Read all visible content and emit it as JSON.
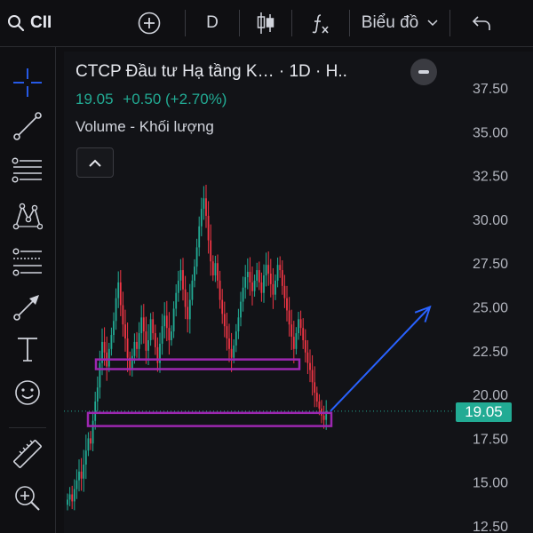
{
  "toolbar": {
    "symbol": "CII",
    "interval": "D",
    "chart_type_label": "Biểu đồ",
    "icons": [
      "search-icon",
      "add-icon",
      "candles-icon",
      "function-icon",
      "chevron-down-icon",
      "undo-icon"
    ]
  },
  "sidebar": {
    "tools": [
      "crosshair-icon",
      "trend-line-icon",
      "fib-icon",
      "pattern-icon",
      "forecast-icon",
      "arrow-icon",
      "text-icon",
      "emoji-icon",
      "ruler-icon",
      "zoom-in-icon"
    ]
  },
  "legend": {
    "title": "CTCP Đầu tư Hạ tầng K… · 1D · H..",
    "price": "19.05",
    "change": "+0.50 (+2.70%)",
    "volume_label": "Volume - Khối lượng"
  },
  "price_axis": {
    "current_price": "19.05",
    "ticks": [
      "37.50",
      "35.00",
      "32.50",
      "30.00",
      "27.50",
      "25.00",
      "22.50",
      "20.00",
      "17.50",
      "15.00",
      "12.50"
    ]
  },
  "colors": {
    "up": "#22ab94",
    "down": "#f23645",
    "rectangle": "#9c27b0",
    "arrow": "#2962ff",
    "background": "#121317"
  },
  "chart_data": {
    "type": "candlestick",
    "ylim": [
      12.5,
      37.5
    ],
    "y_axis_side": "right",
    "grid": false,
    "current_price": 19.05,
    "closes": [
      14.0,
      14.3,
      13.9,
      14.6,
      15.1,
      15.6,
      15.2,
      16.0,
      16.8,
      17.5,
      17.2,
      18.5,
      19.6,
      20.4,
      21.8,
      23.0,
      22.4,
      21.6,
      22.6,
      23.4,
      24.2,
      25.5,
      26.4,
      25.1,
      24.0,
      23.2,
      22.1,
      21.4,
      22.2,
      23.0,
      22.6,
      23.5,
      24.4,
      23.6,
      22.5,
      23.1,
      24.3,
      23.5,
      22.7,
      21.8,
      22.9,
      23.9,
      24.5,
      23.8,
      23.1,
      23.6,
      24.9,
      25.8,
      26.5,
      27.1,
      26.0,
      25.0,
      24.3,
      25.4,
      26.5,
      27.3,
      28.4,
      29.6,
      30.6,
      31.2,
      30.2,
      28.8,
      27.6,
      26.8,
      27.5,
      26.5,
      25.4,
      24.6,
      23.9,
      23.2,
      22.6,
      22.1,
      22.8,
      23.6,
      24.4,
      25.3,
      26.1,
      26.7,
      27.0,
      26.4,
      25.9,
      26.5,
      27.1,
      26.4,
      25.8,
      26.8,
      27.4,
      26.9,
      26.3,
      25.7,
      26.5,
      27.4,
      27.1,
      26.2,
      25.5,
      24.8,
      24.0,
      23.3,
      22.6,
      23.5,
      24.3,
      23.8,
      23.1,
      22.4,
      21.8,
      21.4,
      20.7,
      20.1,
      19.6,
      19.2,
      18.8,
      18.55,
      19.05
    ],
    "annotations": [
      {
        "type": "rectangle",
        "price_low": 21.45,
        "price_high": 22.0,
        "label": ""
      },
      {
        "type": "rectangle",
        "price_low": 18.2,
        "price_high": 18.95,
        "label": ""
      },
      {
        "type": "arrow",
        "from_price": 19.05,
        "to_price": 25.0,
        "label": ""
      }
    ]
  }
}
